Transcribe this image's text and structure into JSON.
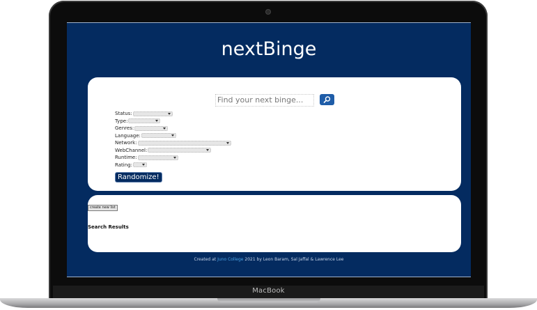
{
  "device": {
    "brand_label": "MacBook"
  },
  "header": {
    "title": "nextBinge"
  },
  "search": {
    "placeholder": "Find your next binge...",
    "button_icon": "search-icon"
  },
  "filters": [
    {
      "label": "Status:",
      "value": ""
    },
    {
      "label": "Type:",
      "value": ""
    },
    {
      "label": "Genres:",
      "value": ""
    },
    {
      "label": "Language:",
      "value": ""
    },
    {
      "label": "Network:",
      "value": ""
    },
    {
      "label": "WebChannel:",
      "value": ""
    },
    {
      "label": "Runtime:",
      "value": ""
    },
    {
      "label": "Rating:",
      "value": ""
    }
  ],
  "actions": {
    "randomize_label": "Randomize!"
  },
  "results": {
    "create_list_label": "create new list",
    "heading": "Search Results"
  },
  "footer": {
    "prefix": "Created at",
    "link_text": "Juno College",
    "suffix": "2021 by Leon Baram, Sal Jaffal & Lawrence Lee"
  },
  "colors": {
    "page_background": "#042b60",
    "card_background": "#ffffff",
    "accent_button": "#1f5da8",
    "footer_link": "#4aa3e6"
  }
}
